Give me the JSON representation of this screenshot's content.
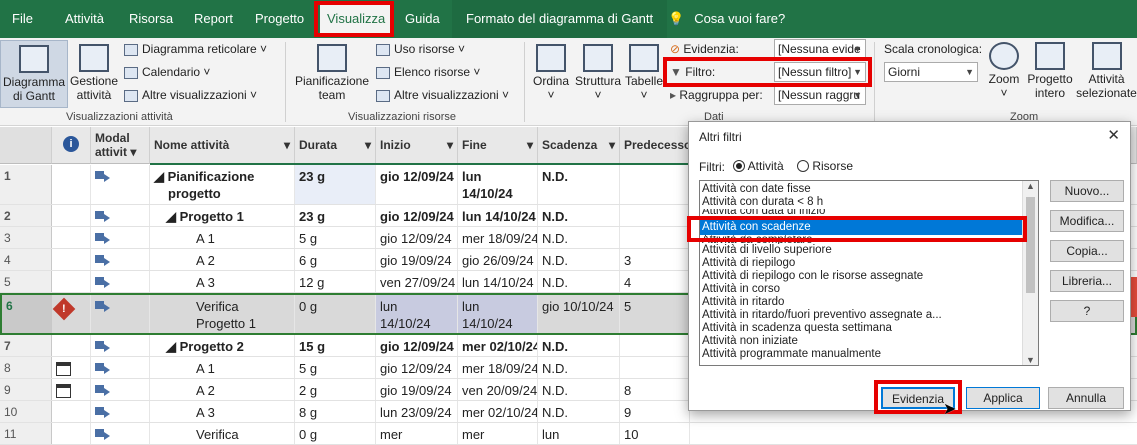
{
  "tabs": {
    "file": "File",
    "tasks": "Attività",
    "resource": "Risorsa",
    "report": "Report",
    "project": "Progetto",
    "view": "Visualizza",
    "help": "Guida",
    "gantt_format": "Formato del diagramma di Gantt"
  },
  "tell_me": "Cosa vuoi fare?",
  "ribbon": {
    "gantt_line1": "Diagramma",
    "gantt_line2": "di Gantt",
    "task_mgmt_line1": "Gestione",
    "task_mgmt_line2": "attività",
    "network": "Diagramma reticolare",
    "calendar": "Calendario",
    "other_views": "Altre visualizzazioni",
    "group_task_views": "Visualizzazioni attività",
    "team_line1": "Pianificazione",
    "team_line2": "team",
    "resource_usage": "Uso risorse",
    "resource_sheet": "Elenco risorse",
    "other_views2": "Altre visualizzazioni",
    "group_resource_views": "Visualizzazioni risorse",
    "sort": "Ordina",
    "outline": "Struttura",
    "tables": "Tabelle",
    "highlight_label": "Evidenzia:",
    "highlight_value": "[Nessuna evide",
    "filter_label": "Filtro:",
    "filter_value": "[Nessun filtro]",
    "group_label": "Raggruppa per:",
    "group_value": "[Nessun raggru",
    "group_data": "Dati",
    "timescale_label": "Scala cronologica:",
    "timescale_value": "Giorni",
    "zoom": "Zoom",
    "entire_line1": "Progetto",
    "entire_line2": "intero",
    "selected_line1": "Attività",
    "selected_line2": "selezionate",
    "group_zoom": "Zoom"
  },
  "columns": {
    "mode_line1": "Modal",
    "mode_line2": "attivit",
    "name": "Nome attività",
    "duration": "Durata",
    "start": "Inizio",
    "finish": "Fine",
    "deadline": "Scadenza",
    "predecessors": "Predecesso"
  },
  "rows": [
    {
      "id": "1",
      "name1": "Pianificazione",
      "name2": "progetto",
      "dur": "23 g",
      "start": "gio 12/09/24",
      "fin1": "lun",
      "fin2": "14/10/24",
      "deadline": "N.D.",
      "pred": ""
    },
    {
      "id": "2",
      "name1": "Progetto 1",
      "name2": "",
      "dur": "23 g",
      "start": "gio 12/09/24",
      "fin1": "lun 14/10/24",
      "fin2": "",
      "deadline": "N.D.",
      "pred": ""
    },
    {
      "id": "3",
      "name1": "A 1",
      "name2": "",
      "dur": "5 g",
      "start": "gio 12/09/24",
      "fin1": "mer 18/09/24",
      "fin2": "",
      "deadline": "N.D.",
      "pred": ""
    },
    {
      "id": "4",
      "name1": "A 2",
      "name2": "",
      "dur": "6 g",
      "start": "gio 19/09/24",
      "fin1": "gio 26/09/24",
      "fin2": "",
      "deadline": "N.D.",
      "pred": "3"
    },
    {
      "id": "5",
      "name1": "A 3",
      "name2": "",
      "dur": "12 g",
      "start": "ven 27/09/24",
      "fin1": "lun 14/10/24",
      "fin2": "",
      "deadline": "N.D.",
      "pred": "4"
    },
    {
      "id": "6",
      "name1": "Verifica",
      "name2": "Progetto 1",
      "dur": "0 g",
      "start1": "lun",
      "start2": "14/10/24",
      "fin1": "lun",
      "fin2": "14/10/24",
      "deadline": "gio 10/10/24",
      "pred": "5"
    },
    {
      "id": "7",
      "name1": "Progetto 2",
      "name2": "",
      "dur": "15 g",
      "start": "gio 12/09/24",
      "fin1": "mer 02/10/24",
      "fin2": "",
      "deadline": "N.D.",
      "pred": ""
    },
    {
      "id": "8",
      "name1": "A 1",
      "name2": "",
      "dur": "5 g",
      "start": "gio 12/09/24",
      "fin1": "mer 18/09/24",
      "fin2": "",
      "deadline": "N.D.",
      "pred": ""
    },
    {
      "id": "9",
      "name1": "A 2",
      "name2": "",
      "dur": "2 g",
      "start": "gio 19/09/24",
      "fin1": "ven 20/09/24",
      "fin2": "",
      "deadline": "N.D.",
      "pred": "8"
    },
    {
      "id": "10",
      "name1": "A 3",
      "name2": "",
      "dur": "8 g",
      "start": "lun 23/09/24",
      "fin1": "mer 02/10/24",
      "fin2": "",
      "deadline": "N.D.",
      "pred": "9"
    },
    {
      "id": "11",
      "name1": "Verifica",
      "name2": "",
      "dur": "0 g",
      "start": "mer",
      "fin1": "mer",
      "fin2": "",
      "deadline": "lun",
      "pred": "10"
    }
  ],
  "dialog": {
    "title": "Altri filtri",
    "filters_label": "Filtri:",
    "radio_tasks": "Attività",
    "radio_resources": "Risorse",
    "items": [
      "Attività con date fisse",
      "Attività con durata < 8 h",
      "Attività con scadenze",
      "Attività da completare",
      "Attività di livello superiore",
      "Attività di riepilogo",
      "Attività di riepilogo con le risorse assegnate",
      "Attività in corso",
      "Attività in ritardo",
      "Attività in ritardo/fuori preventivo assegnate a...",
      "Attività in scadenza questa settimana",
      "Attività non iniziate",
      "Attività programmate manualmente"
    ],
    "partial_item": "Attività con data di inizio",
    "btn_new": "Nuovo...",
    "btn_edit": "Modifica...",
    "btn_copy": "Copia...",
    "btn_library": "Libreria...",
    "btn_help": "?",
    "btn_highlight": "Evidenzia",
    "btn_apply": "Applica",
    "btn_cancel": "Annulla",
    "close": "✕"
  },
  "colors": {
    "accent": "#217346",
    "highlight_border": "#e60000",
    "selection": "#0078d7"
  }
}
